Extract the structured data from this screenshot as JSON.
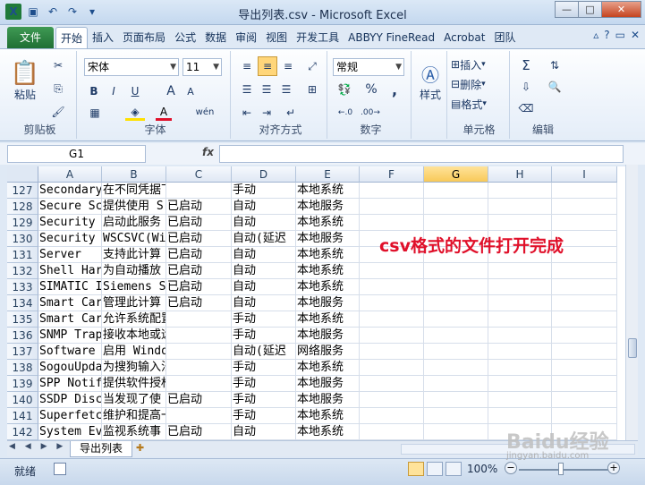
{
  "window": {
    "title": "导出列表.csv - Microsoft Excel",
    "minimize_glyph": "—",
    "maximize_glyph": "□",
    "close_glyph": "✕"
  },
  "quick_access": {
    "logo_letter": "X",
    "save_icon": "save-icon",
    "undo_icon": "undo-icon",
    "redo_icon": "redo-icon"
  },
  "tabs": [
    "文件",
    "开始",
    "插入",
    "页面布局",
    "公式",
    "数据",
    "审阅",
    "视图",
    "开发工具",
    "ABBYY FineRead",
    "Acrobat",
    "团队"
  ],
  "ribbon": {
    "clipboard": {
      "paste_label": "粘贴",
      "group_label": "剪贴板"
    },
    "font": {
      "font_name": "宋体",
      "font_size": "11",
      "bold": "B",
      "italic": "I",
      "underline": "U",
      "grow": "A",
      "shrink": "A",
      "color_letter": "A",
      "wen": "wén",
      "group_label": "字体"
    },
    "alignment": {
      "group_label": "对齐方式"
    },
    "number": {
      "format": "常规",
      "percent": "%",
      "comma": ",",
      "group_label": "数字"
    },
    "styles": {
      "label": "样式"
    },
    "cells": {
      "insert": "插入",
      "delete": "删除",
      "format": "格式",
      "group_label": "单元格"
    },
    "editing": {
      "sigma": "Σ",
      "group_label": "编辑"
    }
  },
  "formula_bar": {
    "name_box": "G1",
    "fx": "fx",
    "value": ""
  },
  "columns": [
    "A",
    "B",
    "C",
    "D",
    "E",
    "F",
    "G",
    "H",
    "I"
  ],
  "selected_column": "G",
  "rows": [
    {
      "num": "127",
      "a": "Secondary",
      "b": "在不同凭据下启用启动",
      "c": "",
      "d": "手动",
      "e": "本地系统"
    },
    {
      "num": "128",
      "a": "Secure Sc",
      "b": "提供使用 S",
      "c": "已启动",
      "d": "自动",
      "e": "本地服务"
    },
    {
      "num": "129",
      "a": "Security",
      "b": "启动此服务",
      "c": "已启动",
      "d": "自动",
      "e": "本地系统"
    },
    {
      "num": "130",
      "a": "Security",
      "b": "WSCSVC(Wi",
      "c": "已启动",
      "d": "自动(延迟",
      "e": "本地服务"
    },
    {
      "num": "131",
      "a": "Server",
      "b": "支持此计算",
      "c": "已启动",
      "d": "自动",
      "e": "本地系统"
    },
    {
      "num": "132",
      "a": "Shell Har",
      "b": "为自动播放",
      "c": "已启动",
      "d": "自动",
      "e": "本地系统"
    },
    {
      "num": "133",
      "a": "SIMATIC I",
      "b": "Siemens S",
      "c": "已启动",
      "d": "自动",
      "e": "本地系统"
    },
    {
      "num": "134",
      "a": "Smart Car",
      "b": "管理此计算",
      "c": "已启动",
      "d": "自动",
      "e": "本地服务"
    },
    {
      "num": "135",
      "a": "Smart Car",
      "b": "允许系统配置为移除智",
      "c": "",
      "d": "手动",
      "e": "本地系统"
    },
    {
      "num": "136",
      "a": "SNMP Trap",
      "b": "接收本地或远程简单网",
      "c": "",
      "d": "手动",
      "e": "本地服务"
    },
    {
      "num": "137",
      "a": "Software",
      "b": "启用 Windows 和 Wi",
      "c": "",
      "d": "自动(延迟",
      "e": "网络服务"
    },
    {
      "num": "138",
      "a": "SogouUpda",
      "b": "为搜狗输入法提供升级",
      "c": "",
      "d": "手动",
      "e": "本地系统"
    },
    {
      "num": "139",
      "a": "SPP Notif",
      "b": "提供软件授权激活和通",
      "c": "",
      "d": "手动",
      "e": "本地服务"
    },
    {
      "num": "140",
      "a": "SSDP Disc",
      "b": "当发现了使",
      "c": "已启动",
      "d": "手动",
      "e": "本地服务"
    },
    {
      "num": "141",
      "a": "Superfetc",
      "b": "维护和提高一段时间内",
      "c": "",
      "d": "手动",
      "e": "本地系统"
    },
    {
      "num": "142",
      "a": "System Ev",
      "b": "监视系统事",
      "c": "已启动",
      "d": "自动",
      "e": "本地系统"
    }
  ],
  "annotation": "csv格式的文件打开完成",
  "sheet_nav": "◀ ◀ ▶ ▶",
  "sheet_tab": "导出列表",
  "status": {
    "ready": "就绪",
    "zoom": "100%",
    "zoom_minus": "−",
    "zoom_plus": "+"
  },
  "watermark": {
    "brand": "Baidu经验",
    "url": "jingyan.baidu.com"
  },
  "colors": {
    "annotation": "#e0102a",
    "file_tab": "#2a8a45",
    "selected_header": "#f8c959"
  }
}
